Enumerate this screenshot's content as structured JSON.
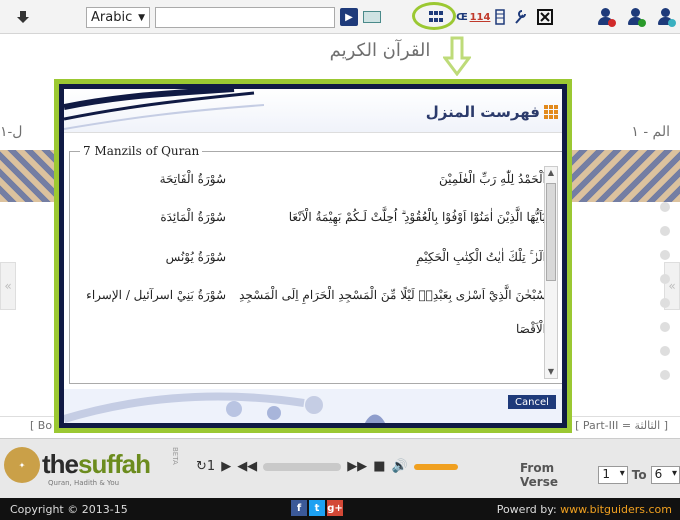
{
  "toolbar": {
    "language_selected": "Arabic",
    "search_placeholder": "",
    "search_button_label": "▶",
    "language_icon_label": "Œ",
    "index_icon_label": "114"
  },
  "background": {
    "page_title": "القرآن الكريم",
    "left_title": "ل-١",
    "right_title": "الم - ١",
    "left_book_label": "[ Bo",
    "right_part_label": "[ Part-III = الثالثة ]",
    "left_nav": "«",
    "right_nav": "«"
  },
  "dialog": {
    "title": "فهرست المنزل",
    "legend": "7 Manzils of Quran",
    "items": [
      {
        "ayah": "اَلْحَمْدُ لِلّٰهِ رَبِّ الْعٰلَمِيْنَ",
        "surah": "سُوْرَةُ الْفَاتِحَة"
      },
      {
        "ayah": "يٰٓاَيُّهَا الَّذِيْنَ اٰمَنُوْٓا اَوْفُوْا بِالْعُقُوْدِ ۗ اُحِلَّتْ لَـكُمْ بَهِيْمَةُ الْاَنْعَا",
        "surah": "سُوْرَةُ الْمَائِدَة"
      },
      {
        "ayah": "الٓرٰ ۚ تِلْكَ اٰيٰتُ الْكِتٰبِ الْحَكِيْمِ",
        "surah": "سُوْرَةُ يُوْنُس"
      },
      {
        "ayah": "سُبْحٰنَ الَّذِيْٓ اَسْرٰى بِعَبْدِهٖ لَيْلًا مِّنَ الْمَسْجِدِ الْحَرَامِ اِلَى الْمَسْجِدِ",
        "surah": "سُوْرَةُ بَنِيْ اسرآئيل / الإسراء"
      },
      {
        "ayah": "الْاَقْصَا",
        "surah": ""
      }
    ],
    "cancel_label": "Cancel"
  },
  "player": {
    "brand_left": "the",
    "brand_right": "suffah",
    "tagline": "Quran, Hadith & You",
    "beta": "BETA",
    "repeat_label": "1",
    "from_verse_label": "From Verse",
    "from_verse_value": "1",
    "to_label": "To",
    "to_value": "6"
  },
  "footer": {
    "copyright": "Copyright © 2013-15",
    "powered_label": "Powerd by:",
    "powered_link": "www.bitguiders.com"
  },
  "colors": {
    "accent_green": "#9bc832",
    "navy": "#1e3a7a"
  }
}
